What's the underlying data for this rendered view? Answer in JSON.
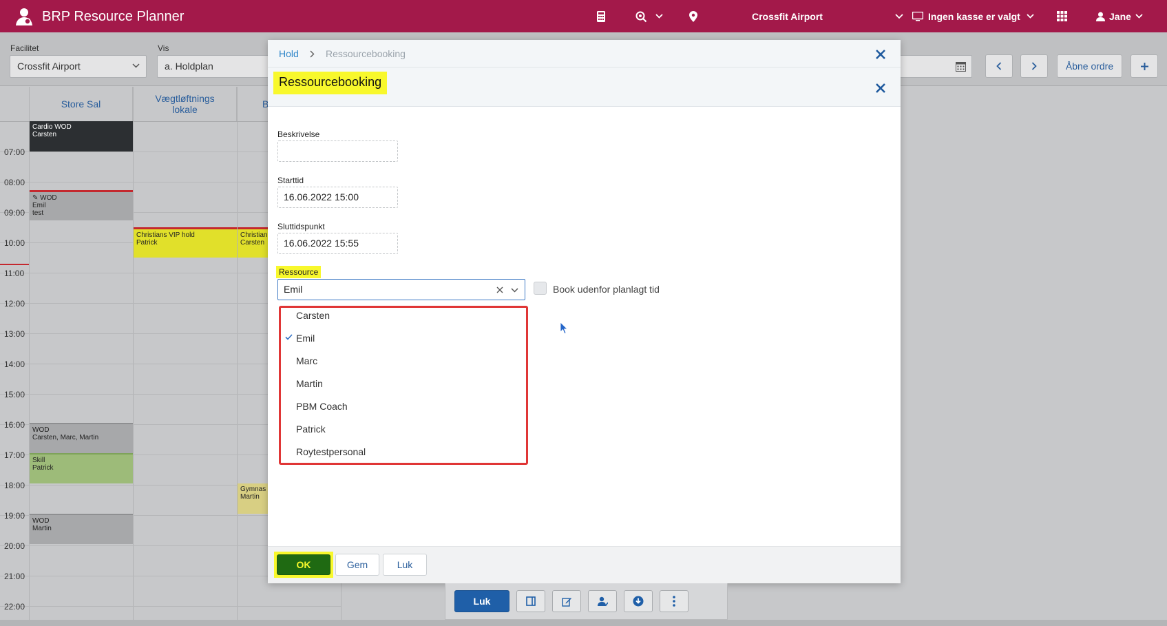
{
  "app": {
    "title": "BRP Resource Planner"
  },
  "topbar": {
    "facility": "Crossfit Airport",
    "register": "Ingen kasse er valgt",
    "user": "Jane"
  },
  "filters": {
    "facility_label": "Facilitet",
    "facility_value": "Crossfit Airport",
    "view_label": "Vis",
    "view_value": "a. Holdplan",
    "open_orders": "Åbne ordre"
  },
  "calendar": {
    "columns": [
      "Store Sal",
      "Vægtløftnings\nlokale",
      "B"
    ],
    "times": [
      "07:00",
      "08:00",
      "09:00",
      "10:00",
      "11:00",
      "12:00",
      "13:00",
      "14:00",
      "15:00",
      "16:00",
      "17:00",
      "18:00",
      "19:00",
      "20:00",
      "21:00",
      "22:00"
    ],
    "events": [
      {
        "title": "Cardio WOD",
        "sub": "Carsten"
      },
      {
        "title": "WOD",
        "sub": "Emil",
        "sub2": "test"
      },
      {
        "title": "Christians VIP hold",
        "sub": "Patrick"
      },
      {
        "title": "Christian",
        "sub": "Carsten"
      },
      {
        "title": "WOD",
        "sub": "Carsten, Marc, Martin"
      },
      {
        "title": "Skill",
        "sub": "Patrick"
      },
      {
        "title": "Gymnas",
        "sub": "Martin"
      },
      {
        "title": "WOD",
        "sub": "Martin"
      }
    ],
    "colors": {
      "dark": "#2c2f32",
      "gray": "#a7a8aa",
      "yellow": "#e1e02a",
      "green": "#9dbb79",
      "khaki": "#d8cf83"
    }
  },
  "modal": {
    "breadcrumb": {
      "parent": "Hold",
      "current": "Ressourcebooking"
    },
    "title": "Ressourcebooking",
    "fields": {
      "description_label": "Beskrivelse",
      "description_value": "",
      "start_label": "Starttid",
      "start_value": "16.06.2022 15:00",
      "end_label": "Sluttidspunkt",
      "end_value": "16.06.2022 15:55",
      "resource_label": "Ressource",
      "resource_value": "Emil"
    },
    "resource_options": [
      "Carsten",
      "Emil",
      "Marc",
      "Martin",
      "PBM Coach",
      "Patrick",
      "Roytestpersonal"
    ],
    "selected_option": "Emil",
    "checkbox_label": "Book udenfor planlagt tid",
    "buttons": {
      "ok": "OK",
      "save": "Gem",
      "close": "Luk"
    }
  },
  "bottom_toolbar": {
    "close": "Luk"
  }
}
